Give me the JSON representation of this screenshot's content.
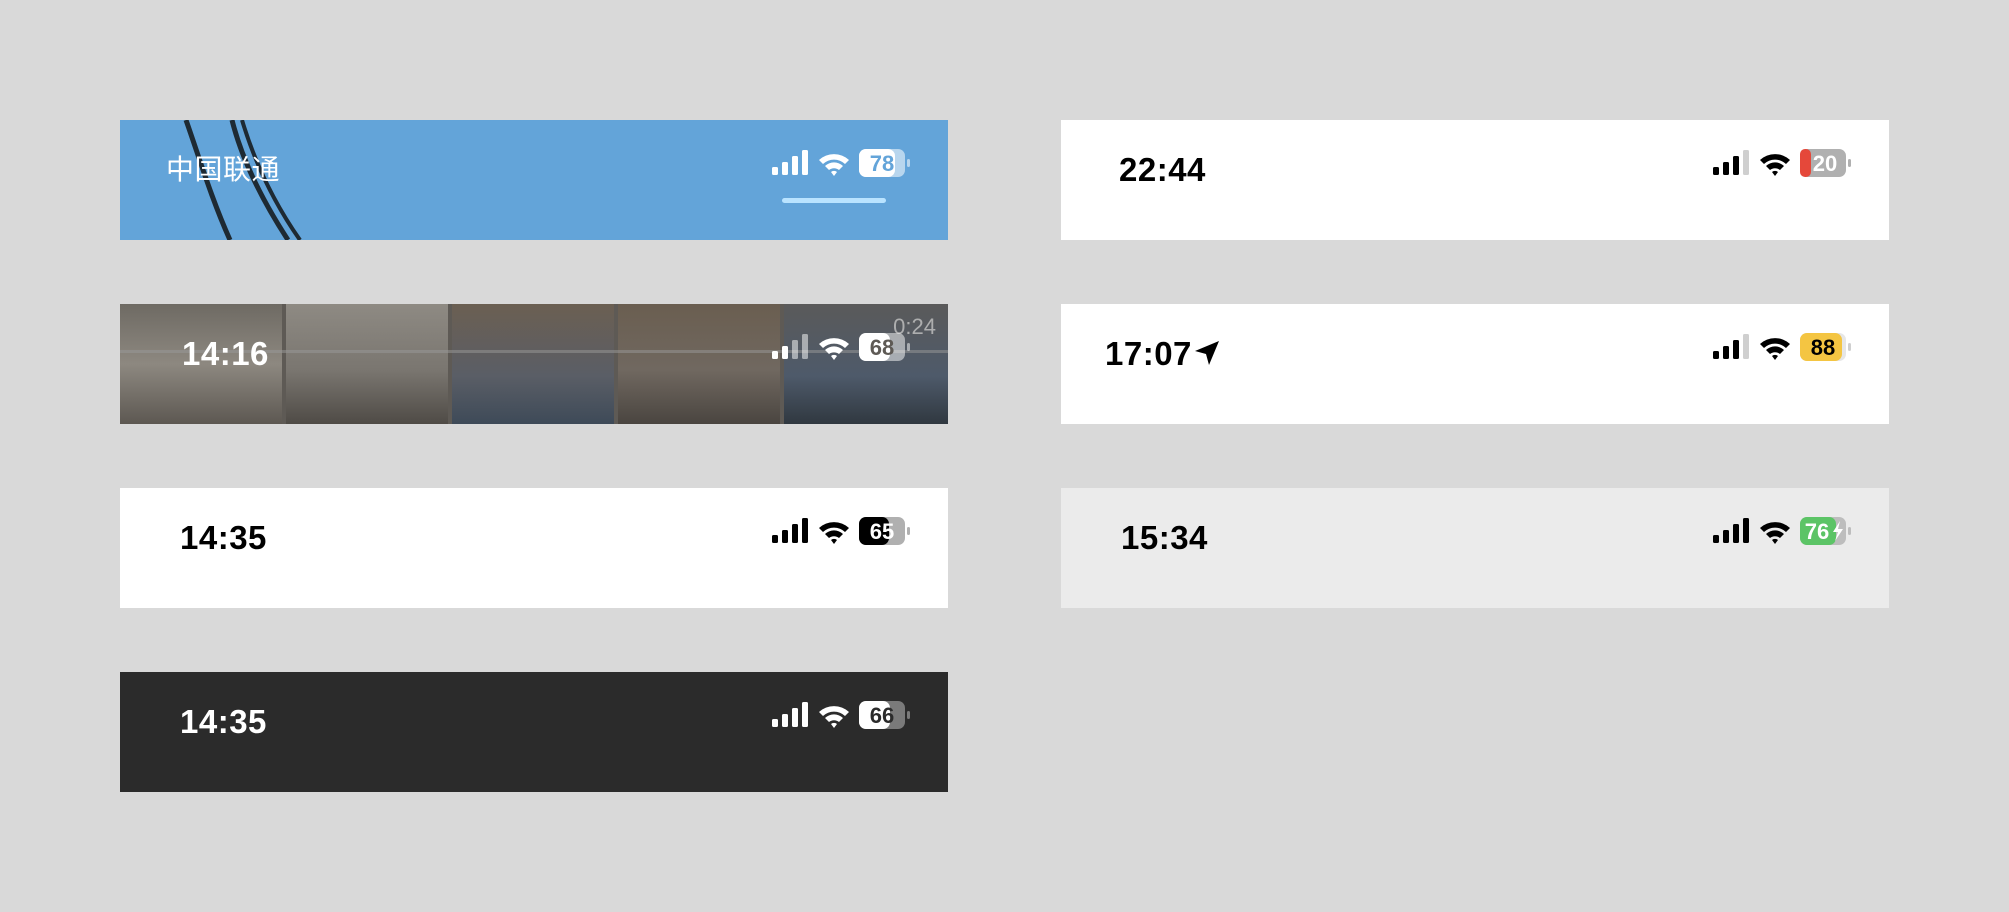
{
  "bars": [
    {
      "id": "carrier",
      "label": "中国联通",
      "battery": "78",
      "theme": "light-on-blue"
    },
    {
      "id": "photos",
      "time": "14:16",
      "battery": "68",
      "video_duration": "0:24",
      "theme": "overlay"
    },
    {
      "id": "white",
      "time": "14:35",
      "battery": "65",
      "theme": "dark-on-light"
    },
    {
      "id": "dark",
      "time": "14:35",
      "battery": "66",
      "theme": "light-on-dark"
    },
    {
      "id": "low-battery",
      "time": "22:44",
      "battery": "20",
      "battery_color": "#e5483a",
      "theme": "dark-on-light"
    },
    {
      "id": "low-power",
      "time": "17:07",
      "battery": "88",
      "battery_color": "#f4c542",
      "location_icon": "location-arrow-icon",
      "theme": "dark-on-light"
    },
    {
      "id": "charging",
      "time": "15:34",
      "battery": "76",
      "battery_color": "#5cc466",
      "charging_icon": "bolt-icon",
      "theme": "dark-on-light"
    }
  ],
  "colors": {
    "page_bg": "#d9d9d9",
    "blue_bg": "#63a4d9",
    "dark_bg": "#2b2b2b",
    "light_gray_bg": "#ebebeb"
  }
}
